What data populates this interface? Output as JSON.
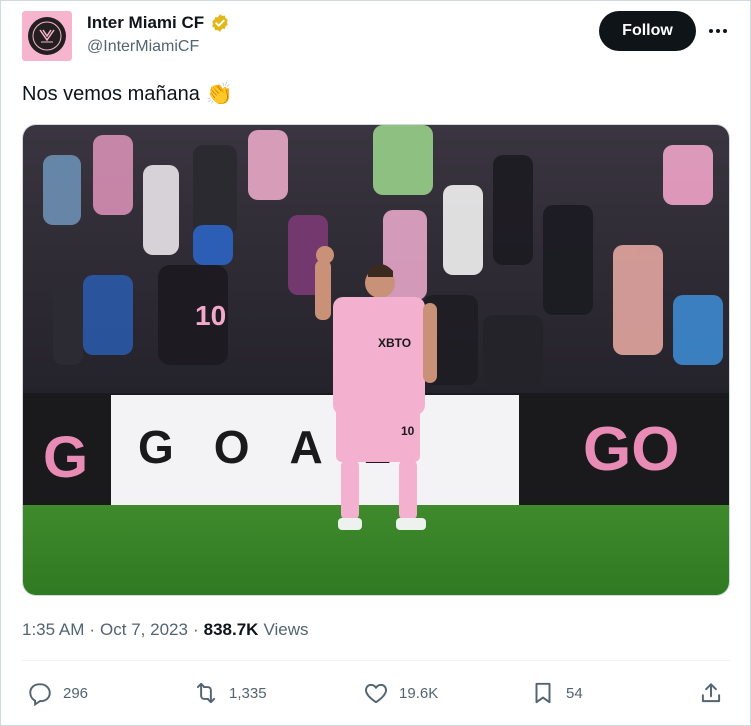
{
  "account": {
    "display_name": "Inter Miami CF",
    "handle": "@InterMiamiCF",
    "verified": true,
    "avatar_badge_text": "INTER MIAMI",
    "brand_pink": "#f7b5cd"
  },
  "header": {
    "follow_label": "Follow",
    "more_icon": "more-horizontal-icon"
  },
  "tweet": {
    "text": "Nos vemos mañana",
    "emoji": "👏",
    "media": {
      "description_icon": "photo",
      "banner_text": "GOAL",
      "jersey_number": "10",
      "jersey_sponsor": "XBTO",
      "board_text": "GO"
    },
    "time": "1:35 AM",
    "separator": "·",
    "date": "Oct 7, 2023",
    "views_count": "838.7K",
    "views_label": "Views"
  },
  "actions": {
    "replies": "296",
    "reposts": "1,335",
    "likes": "19.6K",
    "bookmarks": "54"
  },
  "colors": {
    "text_primary": "#0f1419",
    "text_secondary": "#536471",
    "verified_gold": "#e2b719",
    "follow_bg": "#0f1419"
  }
}
